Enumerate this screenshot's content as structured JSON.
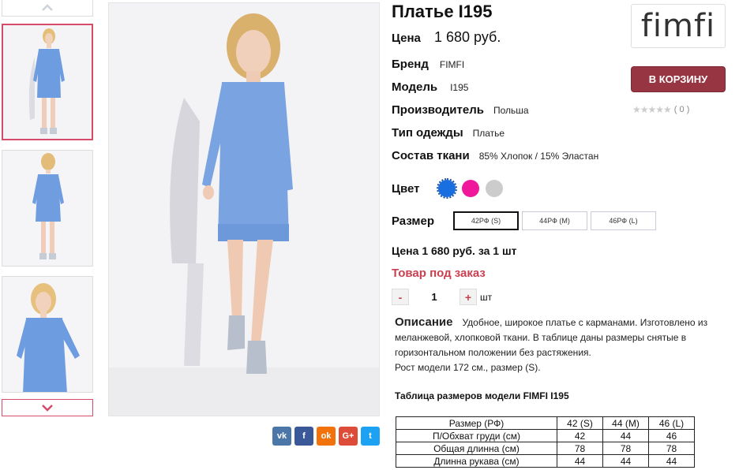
{
  "product": {
    "title": "Платье I195",
    "price_label": "Цена",
    "price_value": "1 680 руб."
  },
  "attributes": [
    {
      "key": "Бренд",
      "value": "FIMFI"
    },
    {
      "key": "Модель",
      "value": "I195"
    },
    {
      "key": "Производитель",
      "value": "Польша"
    },
    {
      "key": "Тип одежды",
      "value": "Платье"
    },
    {
      "key": "Состав ткани",
      "value": "85% Хлопок / 15% Эластан"
    }
  ],
  "brand_logo": {
    "text": "fimfi"
  },
  "cart_button": {
    "label": "В КОРЗИНУ"
  },
  "rating": {
    "stars": "★★★★★",
    "count": "( 0 )"
  },
  "colors": {
    "label": "Цвет",
    "swatches": [
      {
        "name": "blue",
        "hex": "#1a6fe0",
        "selected": true
      },
      {
        "name": "pink",
        "hex": "#f0189a",
        "selected": false
      },
      {
        "name": "gray",
        "hex": "#cccccc",
        "selected": false
      }
    ]
  },
  "sizes": {
    "label": "Размер",
    "options": [
      "42РФ (S)",
      "44РФ (M)",
      "46РФ (L)"
    ],
    "selected": "42РФ (S)"
  },
  "unit_price": "Цена 1 680 руб. за 1 шт",
  "availability": "Товар под заказ",
  "quantity": {
    "minus": "-",
    "value": "1",
    "plus": "+",
    "unit": "шт"
  },
  "description": {
    "heading": "Описание",
    "text": "Удобное, широкое платье с карманами. Изготовлено из меланжевой, хлопковой ткани. В таблице даны размеры снятые в горизонтальном положении без растяжения.",
    "model_info": "Рост модели 172 см., размер (S)."
  },
  "size_table": {
    "title": "Таблица размеров модели FIMFI I195",
    "header": [
      "Размер (РФ)",
      "42 (S)",
      "44 (M)",
      "46 (L)"
    ],
    "rows": [
      [
        "П/Обхват груди (см)",
        "42",
        "44",
        "46"
      ],
      [
        "Общая длинна (см)",
        "78",
        "78",
        "78"
      ],
      [
        "Длинна рукава (см)",
        "44",
        "44",
        "44"
      ]
    ]
  },
  "social": [
    {
      "name": "vk",
      "label": "vk",
      "color": "#4a76a8"
    },
    {
      "name": "facebook",
      "label": "f",
      "color": "#3b5998"
    },
    {
      "name": "odnoklassniki",
      "label": "ok",
      "color": "#f2720c"
    },
    {
      "name": "google-plus",
      "label": "G+",
      "color": "#dd4b39"
    },
    {
      "name": "twitter",
      "label": "t",
      "color": "#1da1f2"
    }
  ],
  "colors_ui": {
    "accent": "#983542",
    "order": "#c8404f",
    "thumb_active": "#d64a6a"
  }
}
